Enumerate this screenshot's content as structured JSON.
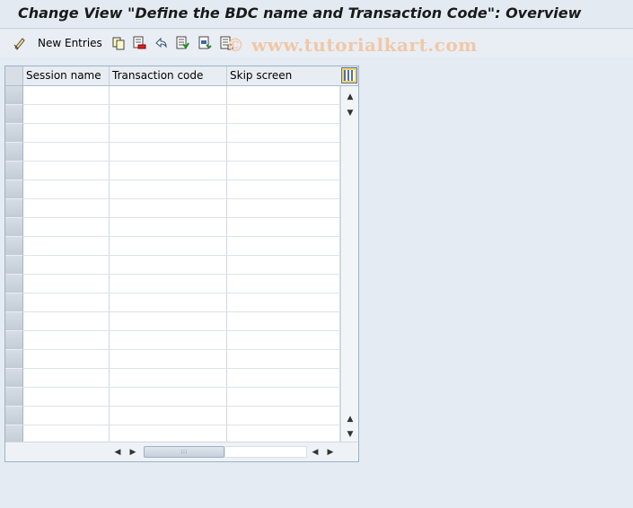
{
  "window": {
    "title": "Change View \"Define the BDC name and Transaction Code\": Overview"
  },
  "toolbar": {
    "new_entries_label": "New Entries",
    "watermark": "© www.tutorialkart.com"
  },
  "table": {
    "columns": [
      "Session name",
      "Transaction code",
      "Skip screen"
    ],
    "row_count": 19,
    "rows": []
  },
  "colors": {
    "title_bar": "#e3eaf2",
    "background": "#dfe6ee",
    "row_selector": "#c9d2dc",
    "watermark": "#f0c8a8"
  }
}
